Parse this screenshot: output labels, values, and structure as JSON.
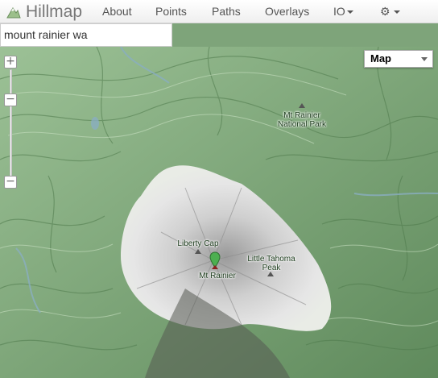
{
  "navbar": {
    "brand": "Hillmap",
    "items": [
      "About",
      "Points",
      "Paths",
      "Overlays"
    ],
    "io_label": "IO"
  },
  "search": {
    "value": "mount rainier wa"
  },
  "map": {
    "type_selector": "Map",
    "zoom_in": "+",
    "zoom_out_top": "−",
    "zoom_out_bottom": "−",
    "labels": {
      "national_park_line1": "Mt Rainier",
      "national_park_line2": "National Park",
      "liberty_cap": "Liberty Cap",
      "mt_rainier": "Mt Rainier",
      "little_tahoma_line1": "Little Tahoma",
      "little_tahoma_line2": "Peak"
    }
  },
  "colors": {
    "forest": "#7ea47a",
    "snow": "#e4e4e4",
    "water": "#8aaec0",
    "marker": "#4caf50"
  }
}
